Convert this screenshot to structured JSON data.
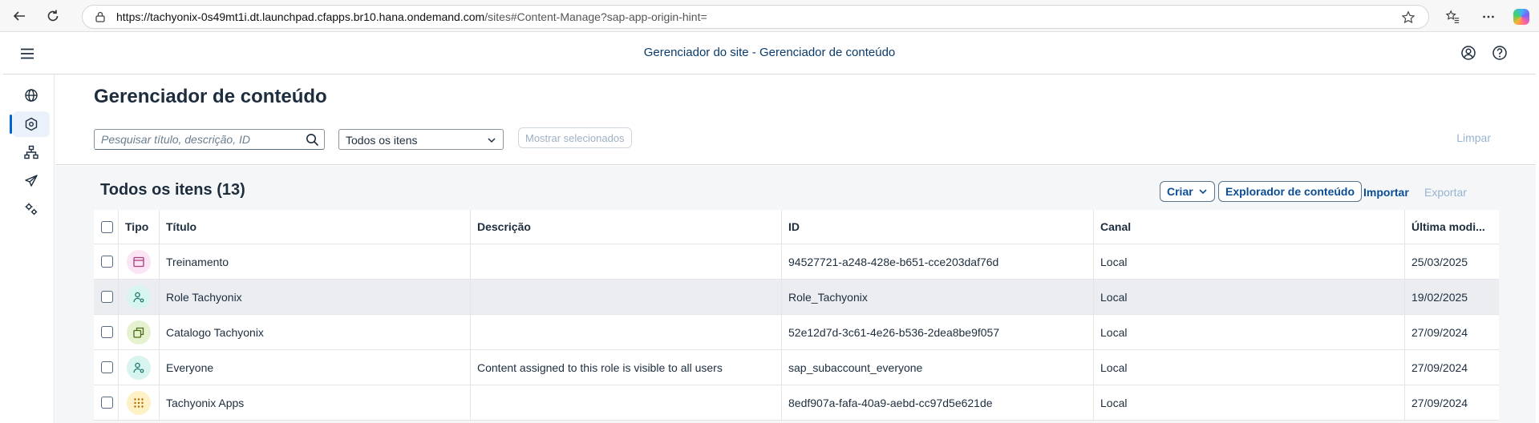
{
  "browser": {
    "url_host": "https://tachyonix-0s49mt1i.dt.launchpad.cfapps.br10.hana.ondemand.com",
    "url_path": "/sites#Content-Manage?sap-app-origin-hint="
  },
  "shell": {
    "title": "Gerenciador do site - Gerenciador de conteúdo"
  },
  "page": {
    "title": "Gerenciador de conteúdo",
    "search_placeholder": "Pesquisar título, descrição, ID",
    "filter_value": "Todos os itens",
    "show_selected": "Mostrar selecionados",
    "clear": "Limpar"
  },
  "table": {
    "title": "Todos os itens (13)",
    "create": "Criar",
    "explorer": "Explorador de conteúdo",
    "import": "Importar",
    "export": "Exportar",
    "headers": [
      "Tipo",
      "Título",
      "Descrição",
      "ID",
      "Canal",
      "Última modi..."
    ],
    "rows": [
      {
        "type": "page",
        "title": "Treinamento",
        "description": "",
        "id": "94527721-a248-428e-b651-cce203daf76d",
        "channel": "Local",
        "modified": "25/03/2025"
      },
      {
        "type": "role",
        "title": "Role Tachyonix",
        "description": "",
        "id": "Role_Tachyonix",
        "channel": "Local",
        "modified": "19/02/2025"
      },
      {
        "type": "catalog",
        "title": "Catalogo Tachyonix",
        "description": "",
        "id": "52e12d7d-3c61-4e26-b536-2dea8be9f057",
        "channel": "Local",
        "modified": "27/09/2024"
      },
      {
        "type": "role",
        "title": "Everyone",
        "description": "Content assigned to this role is visible to all users",
        "id": "sap_subaccount_everyone",
        "channel": "Local",
        "modified": "27/09/2024"
      },
      {
        "type": "group",
        "title": "Tachyonix Apps",
        "description": "",
        "id": "8edf907a-fafa-40a9-aebd-cc97d5e621de",
        "channel": "Local",
        "modified": "27/09/2024"
      }
    ]
  },
  "colors": {
    "page_icon_bg": "#fbe4f4",
    "role_icon_bg": "#d7f4ef",
    "catalog_icon_bg": "#e6f2cf",
    "group_icon_bg": "#fdf1c5",
    "accent": "#0064d9"
  }
}
